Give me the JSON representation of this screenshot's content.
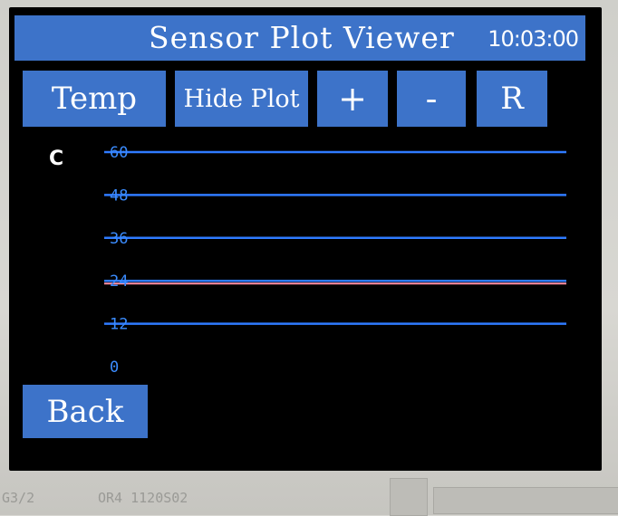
{
  "header": {
    "title": "Sensor Plot Viewer",
    "time": "10:03:00"
  },
  "toolbar": {
    "sensor_label": "Temp",
    "hide_plot_label": "Hide Plot",
    "zoom_in_label": "+",
    "zoom_out_label": "-",
    "reset_label": "R"
  },
  "plot": {
    "unit": "C",
    "y_ticks": [
      "60",
      "48",
      "36",
      "24",
      "12",
      "0"
    ]
  },
  "chart_data": {
    "type": "line",
    "ylim": [
      0,
      60
    ],
    "y_ticks": [
      60,
      48,
      36,
      24,
      12,
      0
    ],
    "gridlines": [
      60,
      48,
      36,
      24,
      12
    ],
    "series": [
      {
        "color": "#ff8fa3",
        "values": [
          24,
          24
        ]
      }
    ],
    "grid": true
  },
  "footer": {
    "back_label": "Back"
  },
  "device": {
    "silkscreen_left": "G3/2",
    "silkscreen_right": "OR4 1120S02"
  },
  "colors": {
    "accent": "#3d73c9",
    "gridline": "#2f7bff",
    "series": "#ff8fa3",
    "background": "#000000"
  }
}
